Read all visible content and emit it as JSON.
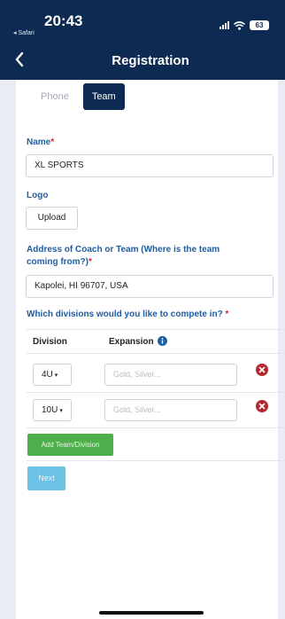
{
  "status": {
    "time": "20:43",
    "back_app": "◂ Safari",
    "battery": "63"
  },
  "nav": {
    "title": "Registration"
  },
  "tabs": [
    {
      "label": "Phone",
      "active": false
    },
    {
      "label": "Team",
      "active": true
    }
  ],
  "form": {
    "name_label": "Name",
    "required_marker": "*",
    "name_value": "XL SPORTS",
    "logo_label": "Logo",
    "upload_label": "Upload",
    "address_label_line1": "Address of Coach or Team (Where is the team",
    "address_label_line2": "coming from?)",
    "address_value": "Kapolei, HI 96707, USA",
    "divisions_question": "Which divisions would you like to compete in?"
  },
  "divisions_table": {
    "col_division": "Division",
    "col_expansion": "Expansion",
    "rows": [
      {
        "division": "4U",
        "expansion_placeholder": "Gold, Silver..."
      },
      {
        "division": "10U",
        "expansion_placeholder": "Gold, Silver..."
      }
    ]
  },
  "actions": {
    "add_label": "Add Team/Division",
    "next_label": "Next"
  },
  "colors": {
    "header_bg": "#0d2a52",
    "label_blue": "#1f5d9f",
    "add_green": "#4fae4c",
    "next_blue": "#6bc2e4",
    "remove_red": "#b3262e"
  }
}
